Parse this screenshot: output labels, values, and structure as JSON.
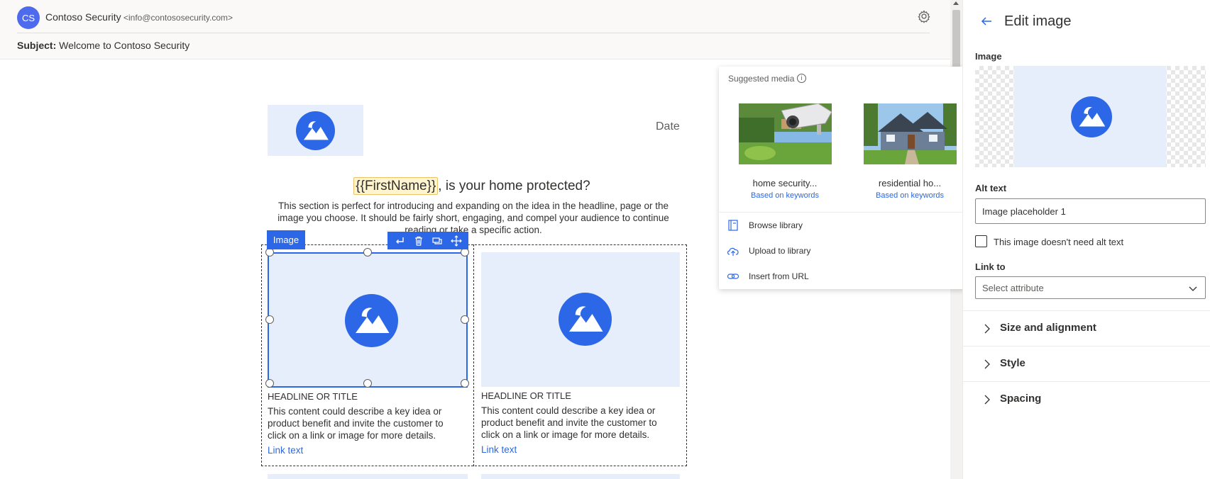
{
  "header": {
    "avatar_initials": "CS",
    "sender_name": "Contoso Security",
    "sender_email": "<info@contososecurity.com>",
    "subject_label": "Subject:",
    "subject": "Welcome to Contoso Security"
  },
  "email": {
    "date": "Date",
    "first_name_token": "{{FirstName}}",
    "headline_rest": ", is your home protected?",
    "intro": "This section is perfect for introducing and expanding on the idea in the headline, page or the image you choose. It should be fairly short, engaging, and compel your audience to continue reading or take a specific action.",
    "image_block_label": "Image",
    "columns": [
      {
        "title": "HEADLINE OR TITLE",
        "body": "This content could describe a key idea or product benefit and invite the customer to click on a link or image for more details.",
        "link": "Link text"
      },
      {
        "title": "HEADLINE OR TITLE",
        "body": "This content could describe a key idea or product benefit and invite the customer to click on a link or image for more details.",
        "link": "Link text"
      }
    ],
    "toolbar_icons": [
      "enter-icon",
      "delete-icon",
      "duplicate-icon",
      "move-icon"
    ]
  },
  "media": {
    "title": "Suggested media",
    "items": [
      {
        "caption": "home security...",
        "sub": "Based on keywords",
        "icon": "security-camera-photo"
      },
      {
        "caption": "residential ho...",
        "sub": "Based on keywords",
        "icon": "house-photo"
      }
    ],
    "actions": [
      {
        "label": "Browse library",
        "icon": "library-icon"
      },
      {
        "label": "Upload to library",
        "icon": "cloud-upload-icon"
      },
      {
        "label": "Insert from URL",
        "icon": "link-icon"
      }
    ]
  },
  "panel": {
    "title": "Edit image",
    "image_label": "Image",
    "alt_label": "Alt text",
    "alt_value": "Image placeholder 1",
    "alt_check_label": "This image doesn't need alt text",
    "alt_checked": false,
    "link_label": "Link to",
    "link_placeholder": "Select attribute",
    "sections": [
      "Size and alignment",
      "Style",
      "Spacing"
    ]
  },
  "colors": {
    "accent": "#2b67e6",
    "placeholder_bg": "#e6edfb",
    "avatar": "#4f6bed",
    "token_bg": "#fff4ce"
  }
}
